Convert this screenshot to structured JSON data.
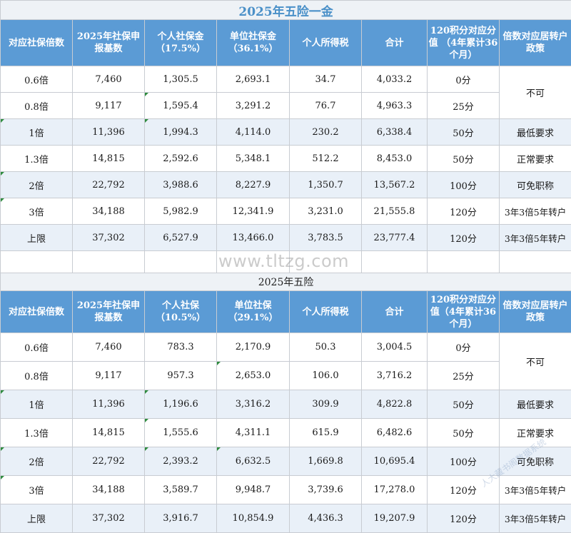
{
  "table1": {
    "title": "2025年五险一金",
    "headers": [
      "对应社保倍数",
      "2025年社保申报基数",
      "个人社保金（17.5%）",
      "单位社保金（36.1%）",
      "个人所得税",
      "合计",
      "120积分对应分值 （4年累计36个月）",
      "倍数对应居转户政策"
    ],
    "rows": [
      {
        "multiple": "0.6倍",
        "base": "7,460",
        "personal": "1,305.5",
        "company": "2,693.1",
        "tax": "34.7",
        "total": "4,033.2",
        "points": "0分"
      },
      {
        "multiple": "0.8倍",
        "base": "9,117",
        "personal": "1,595.4",
        "company": "3,291.2",
        "tax": "76.7",
        "total": "4,963.3",
        "points": "25分"
      },
      {
        "multiple": "1倍",
        "base": "11,396",
        "personal": "1,994.3",
        "company": "4,114.0",
        "tax": "230.2",
        "total": "6,338.4",
        "points": "50分",
        "policy": "最低要求"
      },
      {
        "multiple": "1.3倍",
        "base": "14,815",
        "personal": "2,592.6",
        "company": "5,348.1",
        "tax": "512.2",
        "total": "8,453.0",
        "points": "50分",
        "policy": "正常要求"
      },
      {
        "multiple": "2倍",
        "base": "22,792",
        "personal": "3,988.6",
        "company": "8,227.9",
        "tax": "1,350.7",
        "total": "13,567.2",
        "points": "100分",
        "policy": "可免职称"
      },
      {
        "multiple": "3倍",
        "base": "34,188",
        "personal": "5,982.9",
        "company": "12,341.9",
        "tax": "3,231.0",
        "total": "21,555.8",
        "points": "120分",
        "policy": "3年3倍5年转户"
      },
      {
        "multiple": "上限",
        "base": "37,302",
        "personal": "6,527.9",
        "company": "13,466.0",
        "tax": "3,783.5",
        "total": "23,777.4",
        "points": "120分",
        "policy": "3年3倍5年转户"
      }
    ],
    "merged_policy": "不可"
  },
  "table2": {
    "title": "2025年五险",
    "headers": [
      "对应社保倍数",
      "2025年社保申报基数",
      "个人社保（10.5%）",
      "单位社保（29.1%）",
      "个人所得税",
      "合计",
      "120积分对应分值（4年累计36个月）",
      "倍数对应居转户政策"
    ],
    "rows": [
      {
        "multiple": "0.6倍",
        "base": "7,460",
        "personal": "783.3",
        "company": "2,170.9",
        "tax": "50.3",
        "total": "3,004.5",
        "points": "0分"
      },
      {
        "multiple": "0.8倍",
        "base": "9,117",
        "personal": "957.3",
        "company": "2,653.0",
        "tax": "106.0",
        "total": "3,716.2",
        "points": "25分"
      },
      {
        "multiple": "1倍",
        "base": "11,396",
        "personal": "1,196.6",
        "company": "3,316.2",
        "tax": "309.9",
        "total": "4,822.8",
        "points": "50分",
        "policy": "最低要求"
      },
      {
        "multiple": "1.3倍",
        "base": "14,815",
        "personal": "1,555.6",
        "company": "4,311.1",
        "tax": "615.9",
        "total": "6,482.6",
        "points": "50分",
        "policy": "正常要求"
      },
      {
        "multiple": "2倍",
        "base": "22,792",
        "personal": "2,393.2",
        "company": "6,632.5",
        "tax": "1,669.8",
        "total": "10,695.4",
        "points": "100分",
        "policy": "可免职称"
      },
      {
        "multiple": "3倍",
        "base": "34,188",
        "personal": "3,589.7",
        "company": "9,948.7",
        "tax": "3,739.6",
        "total": "17,278.0",
        "points": "120分",
        "policy": "3年3倍5年转户"
      },
      {
        "multiple": "上限",
        "base": "37,302",
        "personal": "3,916.7",
        "company": "10,854.9",
        "tax": "4,436.3",
        "total": "19,207.9",
        "points": "120分",
        "policy": "3年3倍5年转户"
      }
    ],
    "merged_policy": "不可"
  },
  "watermark": "www.tltzg.com",
  "stamp_text": "人大藏书阁数据系统"
}
